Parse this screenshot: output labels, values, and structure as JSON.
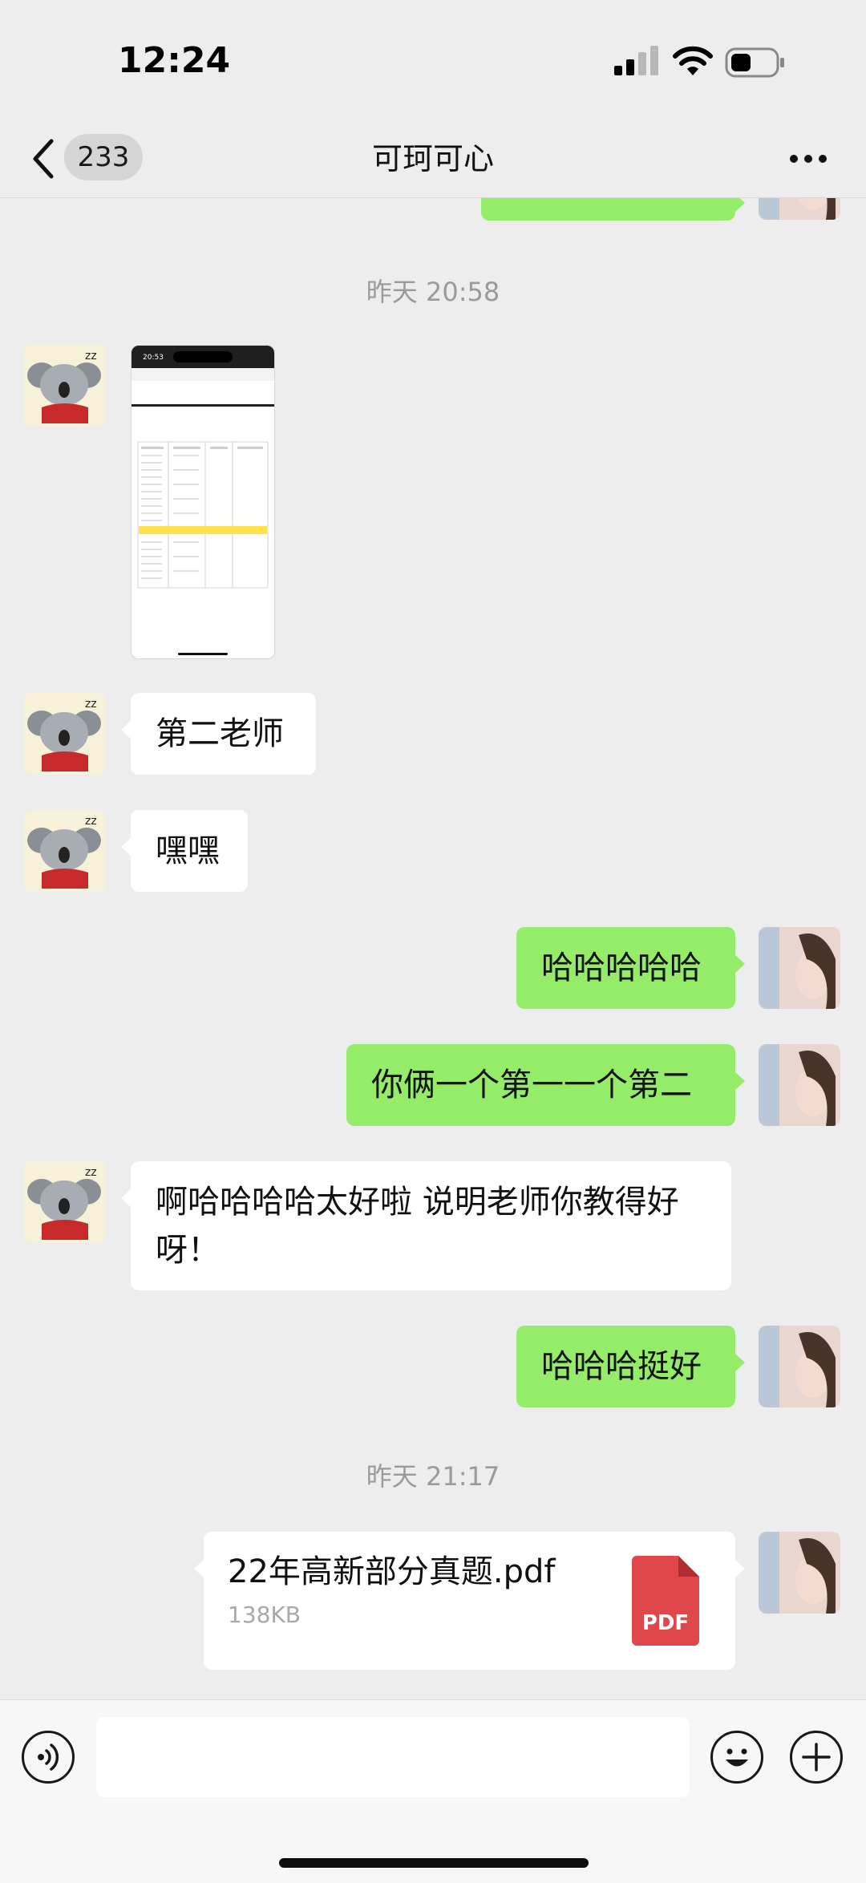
{
  "status_bar": {
    "time": "12:24"
  },
  "nav": {
    "unread_count": "233",
    "title": "可珂可心"
  },
  "messages": {
    "ts1": "昨天 20:58",
    "m1": "第二老师",
    "m2": "嘿嘿",
    "m3": "哈哈哈哈哈",
    "m4": "你俩一个第一一个第二",
    "m5": "啊哈哈哈哈太好啦 说明老师你教得好呀！",
    "m6": "哈哈哈挺好",
    "ts2": "昨天 21:17",
    "file": {
      "name": "22年高新部分真题.pdf",
      "size": "138KB",
      "icon_label": "PDF"
    }
  },
  "screenshot_thumb": {
    "time": "20:53"
  },
  "colors": {
    "outgoing_bubble": "#95ec69",
    "incoming_bubble": "#ffffff",
    "background": "#ededed",
    "pdf_icon": "#e0474a"
  },
  "icons": [
    "back-chevron-icon",
    "more-dots-icon",
    "voice-icon",
    "emoji-icon",
    "plus-icon"
  ]
}
